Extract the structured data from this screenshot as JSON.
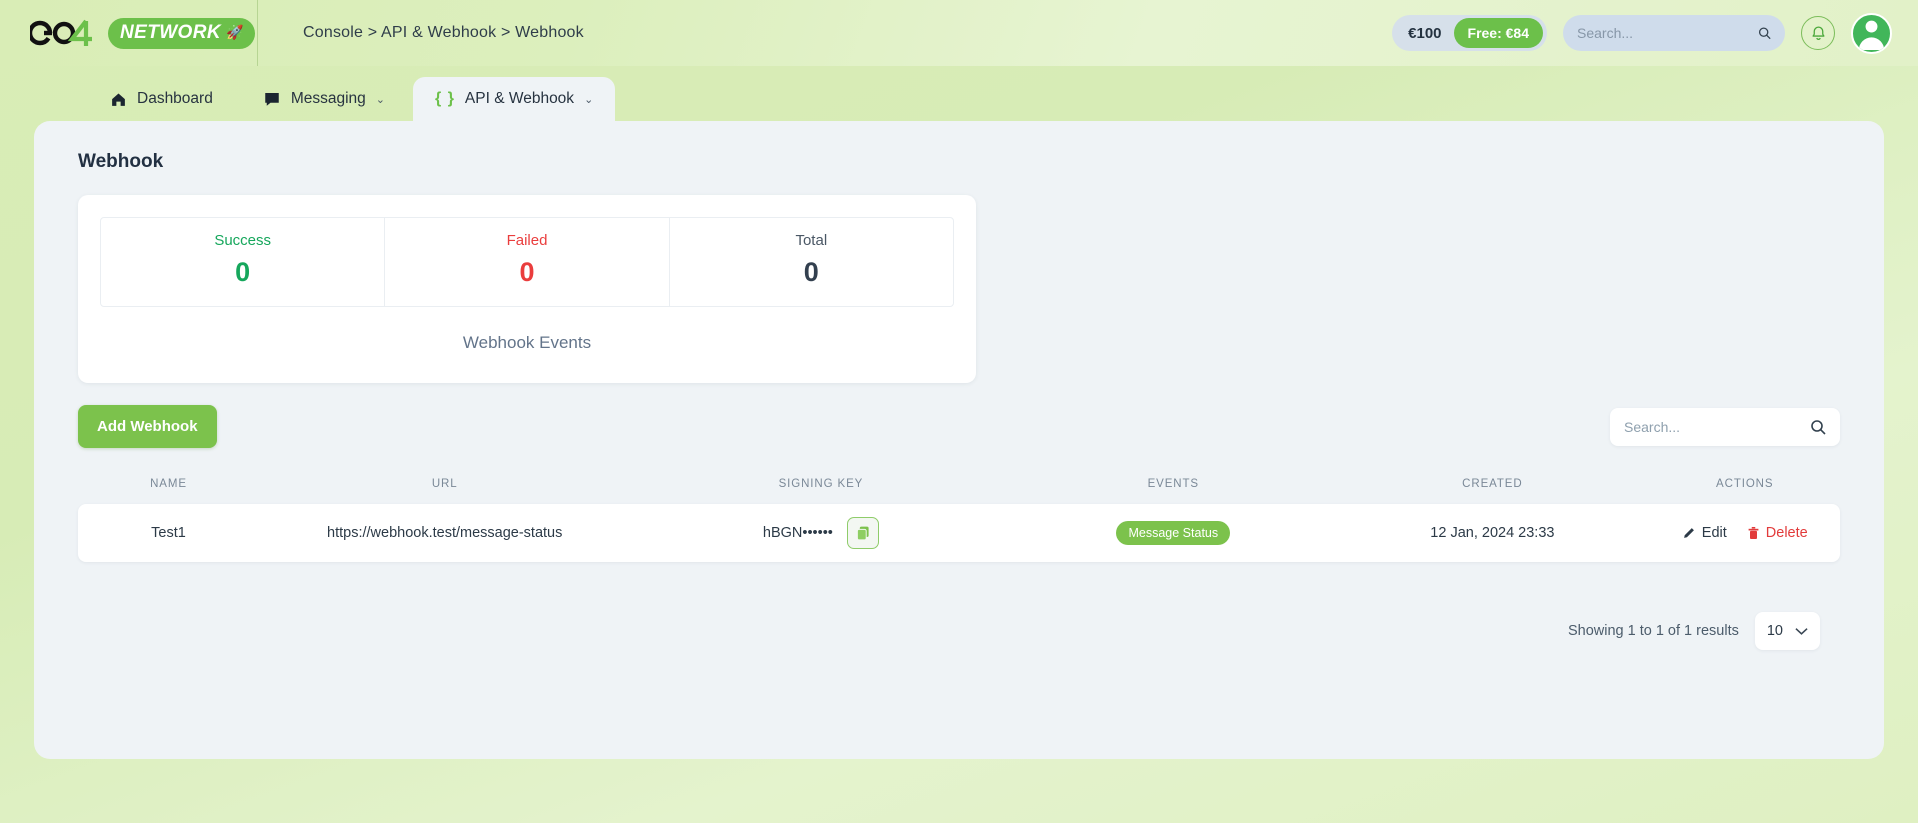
{
  "brand": {
    "go": "GO",
    "four": "4",
    "network": "NETWORK"
  },
  "header": {
    "breadcrumb": "Console > API & Webhook > Webhook",
    "balance_amount": "€100",
    "balance_free": "Free: €84",
    "search_placeholder": "Search...",
    "search_value": ""
  },
  "tabs": [
    {
      "label": "Dashboard",
      "icon": "home-icon",
      "chevron": "",
      "active": false
    },
    {
      "label": "Messaging",
      "icon": "chat-icon",
      "chevron": "⌄",
      "active": false
    },
    {
      "label": "API & Webhook",
      "icon": "braces-icon",
      "chevron": "⌄",
      "active": true
    }
  ],
  "page": {
    "title": "Webhook"
  },
  "stats": {
    "caption": "Webhook Events",
    "items": [
      {
        "label": "Success",
        "value": "0",
        "color": "#16a75c"
      },
      {
        "label": "Failed",
        "value": "0",
        "color": "#ea3d3d"
      },
      {
        "label": "Total",
        "value": "0",
        "color": "#33404f"
      }
    ]
  },
  "toolbar": {
    "add_label": "Add Webhook",
    "search_placeholder": "Search...",
    "search_value": ""
  },
  "table": {
    "columns": [
      "NAME",
      "URL",
      "SIGNING KEY",
      "EVENTS",
      "CREATED",
      "ACTIONS"
    ],
    "rows": [
      {
        "name": "Test1",
        "url": "https://webhook.test/message-status",
        "signing_key": "hBGN••••••",
        "event": "Message Status",
        "created": "12 Jan, 2024 23:33",
        "edit_label": "Edit",
        "delete_label": "Delete"
      }
    ]
  },
  "footer": {
    "showing": "Showing 1 to 1 of 1 results",
    "per_page": "10"
  },
  "colors": {
    "brand_green": "#6cc04a",
    "button_green": "#7cc24c",
    "danger_red": "#e23b3b",
    "panel_bg": "#eff3f6"
  }
}
